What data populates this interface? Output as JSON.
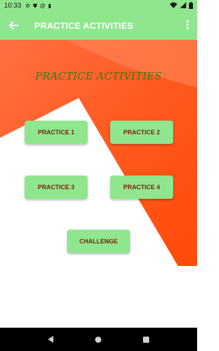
{
  "status_bar": {
    "time": "10:33",
    "icons": [
      "settings-icon",
      "shield-icon",
      "at-icon",
      "sim-icon"
    ],
    "right_icons": [
      "wifi-icon",
      "signal-icon",
      "battery-icon"
    ]
  },
  "app_bar": {
    "title": "PRACTICE ACTIVITIES",
    "back_icon": "arrow-left-icon",
    "overflow_icon": "more-vertical-icon",
    "color": "#8fe68f"
  },
  "main": {
    "heading": "PRACTICE ACTIVITIES",
    "buttons": {
      "practice1": "PRACTICE 1",
      "practice2": "PRACTICE 2",
      "practice3": "PRACTICE 3",
      "practice4": "PRACTICE 4",
      "challenge": "CHALLENGE"
    },
    "colors": {
      "accent_orange": "#ff5a1f",
      "button_bg": "#8fe68f",
      "button_text": "#7a1f0a",
      "heading_text": "#2e7d1a"
    }
  },
  "nav_bar": {
    "back_icon": "triangle-back-icon",
    "home_icon": "circle-home-icon",
    "recent_icon": "square-recent-icon"
  }
}
